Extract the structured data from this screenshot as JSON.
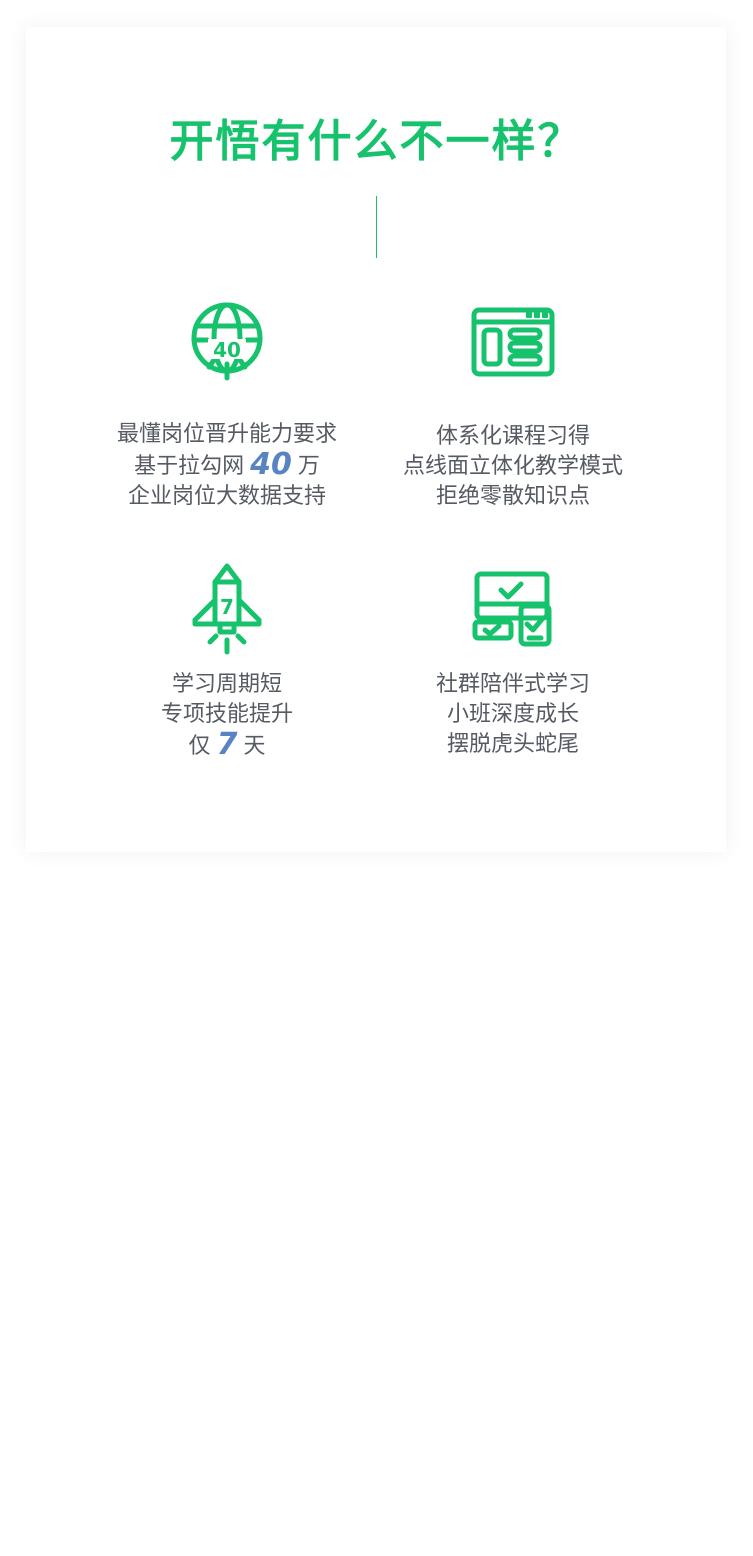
{
  "heading": "开悟有什么不一样？",
  "colors": {
    "accent": "#17c26c",
    "highlight": "#5a83c4",
    "text": "#555a63"
  },
  "features": [
    {
      "icon": "globe-40-icon",
      "line1": "最懂岗位晋升能力要求",
      "line2_pre": "基于拉勾网",
      "line2_num": "40",
      "line2_post": "万",
      "line3": "企业岗位大数据支持"
    },
    {
      "icon": "course-window-icon",
      "line1": "体系化课程习得",
      "line2": "点线面立体化教学模式",
      "line3": "拒绝零散知识点"
    },
    {
      "icon": "rocket-7-icon",
      "line1": "学习周期短",
      "line2": "专项技能提升",
      "line3_pre": "仅",
      "line3_num": "7",
      "line3_post": "天"
    },
    {
      "icon": "multi-device-check-icon",
      "line1": "社群陪伴式学习",
      "line2": "小班深度成长",
      "line3": "摆脱虎头蛇尾"
    }
  ]
}
